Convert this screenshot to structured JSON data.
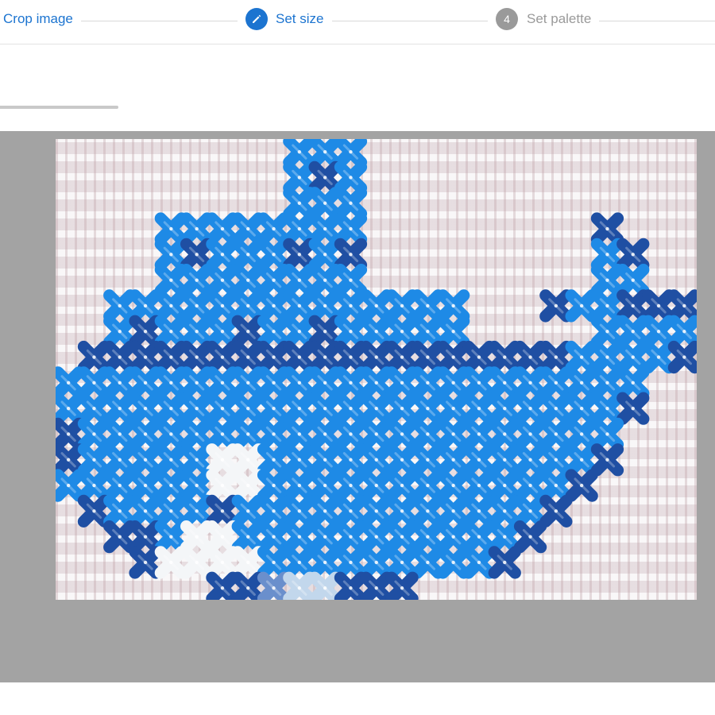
{
  "stepper": {
    "steps": [
      {
        "label": "Crop image",
        "state": "completed"
      },
      {
        "label": "Set size",
        "state": "active",
        "icon": "pencil-icon"
      },
      {
        "number": "4",
        "label": "Set palette",
        "state": "inactive"
      }
    ]
  },
  "preview": {
    "grid": {
      "cols": 25,
      "rows": 18
    },
    "colors": {
      "B": "#1e8ae6",
      "D": "#1f4fa3",
      "W": "#f4f6f8",
      "L": "#6a8fcc",
      "P": "#c2d7ec"
    },
    "pattern": [
      ".........BBB.............",
      ".........BDB.............",
      ".........BBB.............",
      "....BBBBBBBB.........D...",
      "....BDBBBDBD.........BD..",
      "....BBBBBBBB.........BB..",
      "..BBBBBBBBBBBBBB...DBBDDD",
      "..BDBBBDBBDBBBBB.....BBBB",
      ".DDDDDDDDDDDDDDDDDDDBBBBD",
      "BBBBBBBBBBBBBBBBBBBBBBB..",
      "BBBBBBBBBBBBBBBBBBBBBBD..",
      "DBBBBBBBBBBBBBBBBBBBBB...",
      "DBBBBBWWBBBBBBBBBBBBBD...",
      "BBBBBBWWBBBBBBBBBBBBD....",
      ".DBBBBDBBBBBBBBBBBBD.....",
      "..DDBWWBBBBBBBBBBBD......",
      "...DWWWWBBBBBBBBBD.......",
      "......DDLPPDDD..........."
    ]
  }
}
